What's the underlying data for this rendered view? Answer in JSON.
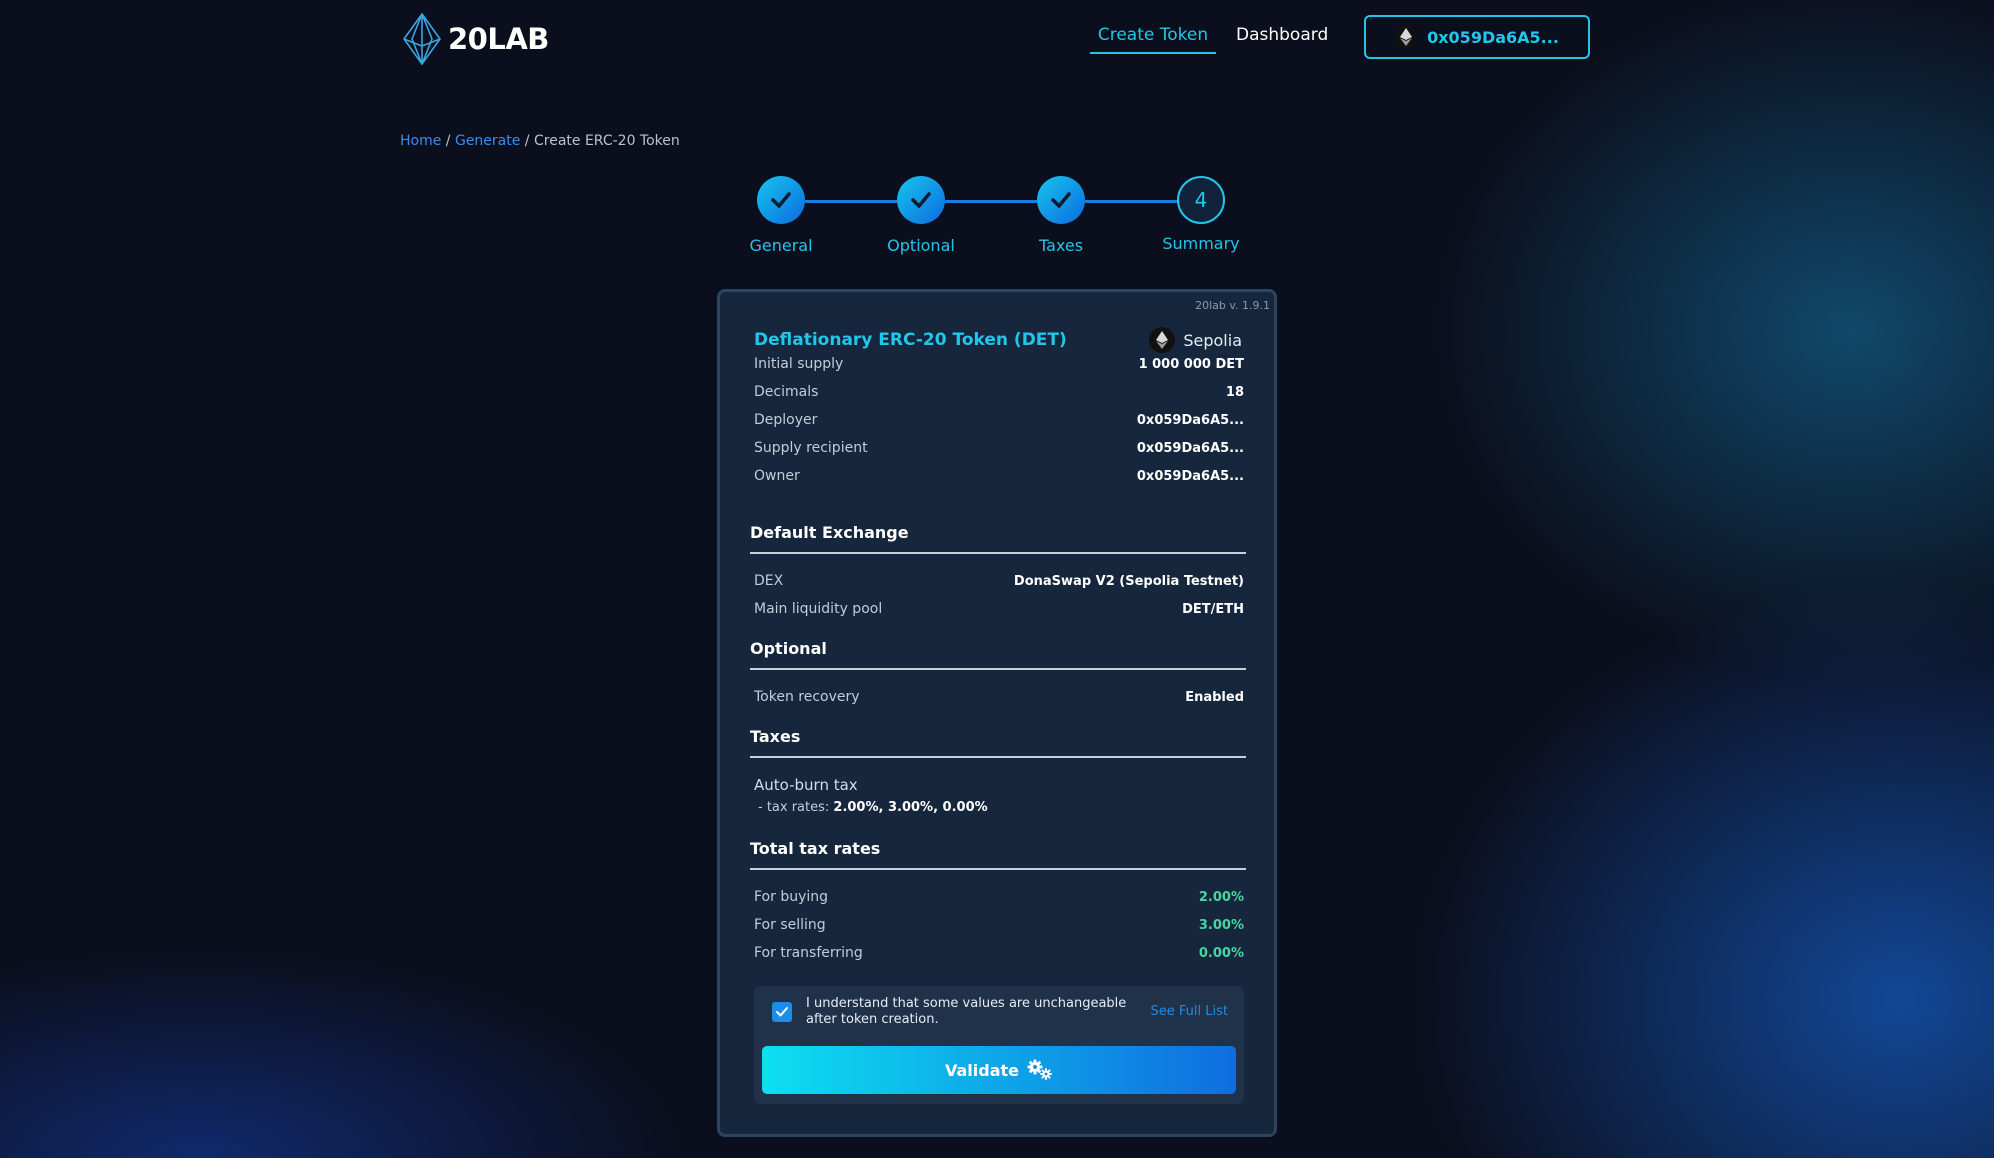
{
  "header": {
    "logo_text": "20LAB",
    "nav": {
      "create_token": "Create Token",
      "dashboard": "Dashboard"
    },
    "wallet_address": "0x059Da6A5..."
  },
  "breadcrumb": {
    "home": "Home",
    "sep1": " / ",
    "generate": "Generate",
    "sep2": " / ",
    "current": "Create ERC-20 Token"
  },
  "stepper": {
    "steps": [
      {
        "label": "General",
        "state": "done"
      },
      {
        "label": "Optional",
        "state": "done"
      },
      {
        "label": "Taxes",
        "state": "done"
      },
      {
        "label": "Summary",
        "state": "current",
        "number": "4"
      }
    ]
  },
  "summary": {
    "version": "20lab v. 1.9.1",
    "title": "Deflationary ERC-20 Token (DET)",
    "network": "Sepolia",
    "general": [
      {
        "key": "Initial supply",
        "value": "1 000 000 DET"
      },
      {
        "key": "Decimals",
        "value": "18"
      },
      {
        "key": "Deployer",
        "value": "0x059Da6A5..."
      },
      {
        "key": "Supply recipient",
        "value": "0x059Da6A5..."
      },
      {
        "key": "Owner",
        "value": "0x059Da6A5..."
      }
    ],
    "exchange": {
      "heading": "Default Exchange",
      "rows": [
        {
          "key": "DEX",
          "value": "DonaSwap V2 (Sepolia Testnet)"
        },
        {
          "key": "Main liquidity pool",
          "value": "DET/ETH"
        }
      ]
    },
    "optional": {
      "heading": "Optional",
      "rows": [
        {
          "key": "Token recovery",
          "value": "Enabled"
        }
      ]
    },
    "taxes": {
      "heading": "Taxes",
      "name": "Auto-burn tax",
      "rates_label": "- tax rates: ",
      "rates_value": "2.00%, 3.00%, 0.00%"
    },
    "total_tax": {
      "heading": "Total tax rates",
      "rows": [
        {
          "key": "For buying",
          "value": "2.00%"
        },
        {
          "key": "For selling",
          "value": "3.00%"
        },
        {
          "key": "For transferring",
          "value": "0.00%"
        }
      ]
    },
    "confirm": {
      "checked": true,
      "text": "I understand that some values are unchangeable after token creation.",
      "see_full_list": "See Full List",
      "validate_label": "Validate"
    }
  },
  "colors": {
    "accent": "#22c6ea",
    "link": "#1c8ee8",
    "green": "#47d6a0",
    "card": "#16263c"
  }
}
